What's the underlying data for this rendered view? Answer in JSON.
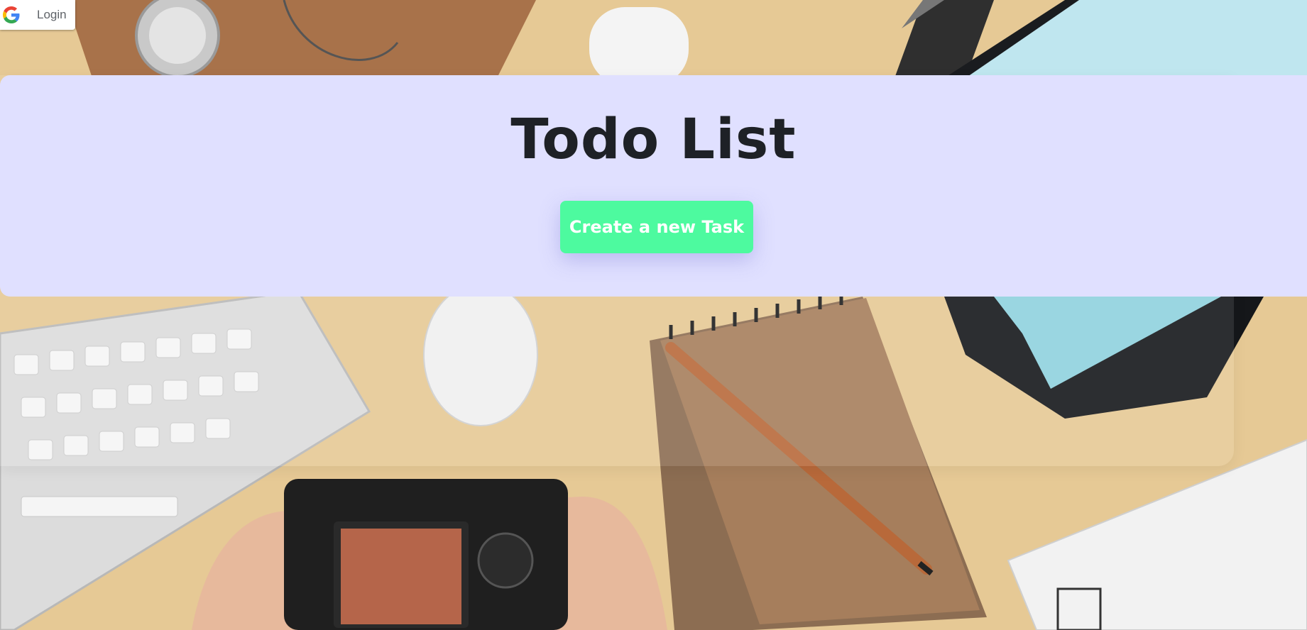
{
  "auth": {
    "login_label": "Login",
    "icon": "google-icon"
  },
  "hero": {
    "title": "Todo List",
    "create_button_label": "Create a new Task",
    "background_color": "#e0e0ff",
    "button_color": "#4dfa9f",
    "title_color": "#1e2126"
  },
  "background": {
    "description_icon": "desk-photo-background",
    "base_color": "#e6c995"
  }
}
